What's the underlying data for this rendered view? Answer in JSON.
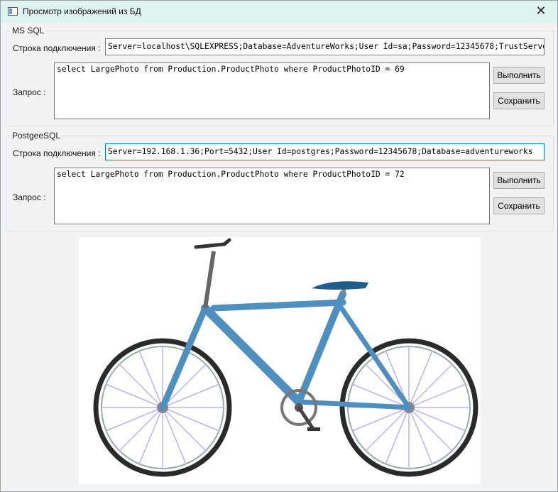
{
  "window": {
    "title": "Просмотр изображений из БД",
    "close_glyph": "✕"
  },
  "mssql": {
    "group_label": "MS SQL",
    "conn_label": "Строка подключения :",
    "conn_value": "Server=localhost\\SQLEXPRESS;Database=AdventureWorks;User Id=sa;Password=12345678;TrustServerCertificate=True",
    "query_label": "Запрос :",
    "query_value": "select LargePhoto from Production.ProductPhoto where ProductPhotoID = 69",
    "execute_label": "Выполнить",
    "save_label": "Сохранить"
  },
  "postgres": {
    "group_label": "PostgeeSQL",
    "conn_label": "Строка подключения :",
    "conn_value": "Server=192.168.1.36;Port=5432;User Id=postgres;Password=12345678;Database=adventureworks",
    "query_label": "Запрос :",
    "query_value": "select LargePhoto from Production.ProductPhoto where ProductPhotoID = 72",
    "execute_label": "Выполнить",
    "save_label": "Сохранить"
  },
  "image": {
    "subject": "bicycle",
    "frame_color": "#4f8fc0"
  }
}
